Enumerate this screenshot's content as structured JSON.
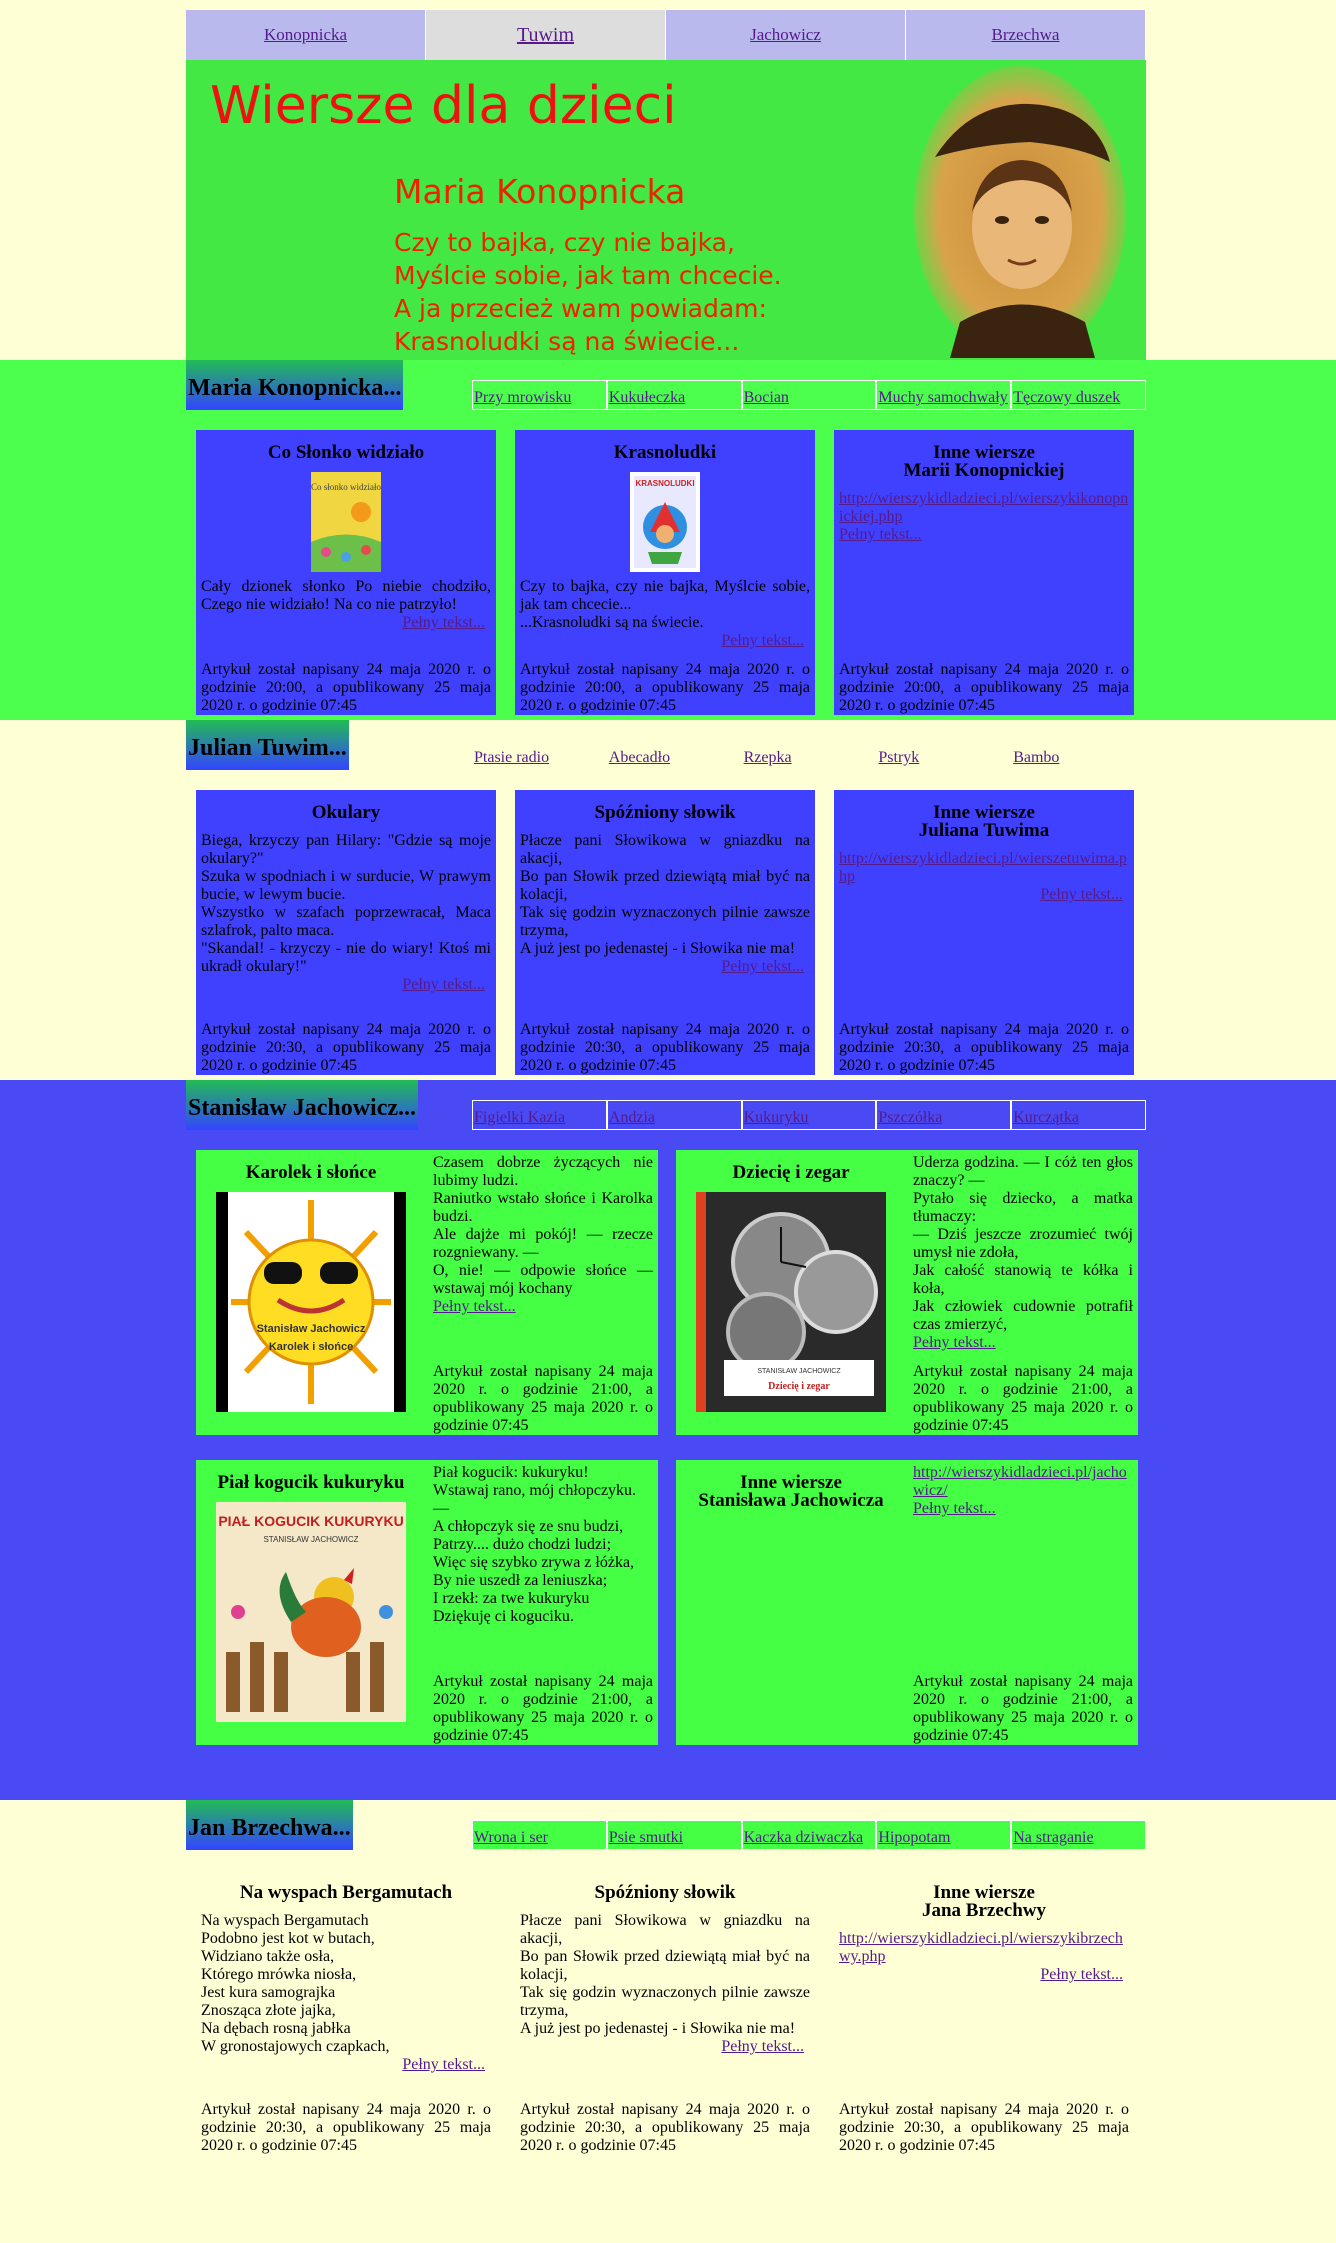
{
  "topnav": [
    "Konopnicka",
    "Tuwim",
    "Jachowicz",
    "Brzechwa"
  ],
  "header": {
    "title": "Wiersze dla dzieci",
    "subtitle": "Maria Konopnicka",
    "verse": "Czy to bajka, czy nie bajka,\nMyślcie sobie, jak tam chcecie.\nA ja przecież wam powiadam:\nKrasnoludki są na świecie..."
  },
  "footer_text": "Artykuł został napisany 24 maja 2020 r. o godzinie 20:00, a opublikowany 25 maja 2020 r. o godzinie 07:45",
  "konopnicka": {
    "title": "Maria Konopnicka...",
    "nav": [
      "Przy mrowisku",
      "Kukułeczka",
      "Bocian",
      "Muchy samochwały",
      "Tęczowy duszek"
    ],
    "cards": [
      {
        "title": "Co Słonko widziało",
        "body": "Cały dzionek słonko Po niebie chodziło, Czego nie widziało! Na co nie patrzyło!",
        "more": "Pełny tekst...",
        "foot": "Artykuł został napisany 24 maja 2020 r. o godzinie 20:00, a opublikowany 25 maja 2020 r. o godzinie 07:45"
      },
      {
        "title": "Krasnoludki",
        "body": "Czy to bajka, czy nie bajka, Myślcie sobie, jak tam chcecie...\n...Krasnoludki są na świecie.",
        "more": "Pełny tekst...",
        "foot": "Artykuł został napisany 24 maja 2020 r. o godzinie 20:00, a opublikowany 25 maja 2020 r. o godzinie 07:45"
      },
      {
        "title": "Inne wiersze\nMarii Konopnickiej",
        "link": "http://wierszykidladzieci.pl/wierszykikonopnickiej.php",
        "more": "Pełny tekst...",
        "foot": "Artykuł został napisany 24 maja 2020 r. o godzinie 20:00, a opublikowany 25 maja 2020 r. o godzinie 07:45"
      }
    ]
  },
  "tuwim": {
    "title": "Julian Tuwim...",
    "nav": [
      "Ptasie radio",
      "Abecadło",
      "Rzepka",
      "Pstryk",
      "Bambo"
    ],
    "cards": [
      {
        "title": "Okulary",
        "body": "Biega, krzyczy pan Hilary: \"Gdzie są moje okulary?\"\nSzuka w spodniach i w surducie, W prawym bucie, w lewym bucie.\nWszystko w szafach poprzewracał, Maca szlafrok, palto maca.\n\"Skandal! - krzyczy - nie do wiary! Ktoś mi ukradł okulary!\"",
        "more": "Pełny tekst...",
        "foot": "Artykuł został napisany 24 maja 2020 r. o godzinie 20:30, a opublikowany 25 maja 2020 r. o godzinie 07:45"
      },
      {
        "title": "Spóźniony słowik",
        "body": "Płacze pani Słowikowa w gniazdku na akacji,\nBo pan Słowik przed dziewiątą miał być na kolacji,\nTak się godzin wyznaczonych pilnie zawsze trzyma,\nA już jest po jedenastej - i Słowika nie ma!",
        "more": "Pełny tekst...",
        "foot": "Artykuł został napisany 24 maja 2020 r. o godzinie 20:30, a opublikowany 25 maja 2020 r. o godzinie 07:45"
      },
      {
        "title": "Inne wiersze\nJuliana Tuwima",
        "link": "http://wierszykidladzieci.pl/wierszetuwima.php",
        "more": "Pełny tekst...",
        "foot": "Artykuł został napisany 24 maja 2020 r. o godzinie 20:30, a opublikowany 25 maja 2020 r. o godzinie 07:45"
      }
    ]
  },
  "jachowicz": {
    "title": "Stanisław Jachowicz...",
    "nav": [
      "Figielki Kazia",
      "Andzia",
      "Kukuryku",
      "Pszczółka",
      "Kurczątka"
    ],
    "cards": [
      {
        "title": "Karolek i słońce",
        "body": "Czasem dobrze życzących nie lubimy ludzi.\nRaniutko wstało słońce i Karolka budzi.\nAle dajże mi pokój! — rzecze rozgniewany. —\nO, nie! — odpowie słońce — wstawaj mój kochany",
        "more": "Pełny tekst...",
        "foot": "Artykuł został napisany 24 maja 2020 r. o godzinie 21:00, a opublikowany 25 maja 2020 r. o godzinie 07:45",
        "cover_author": "Stanisław Jachowicz",
        "cover_title": "Karolek i słońce"
      },
      {
        "title": "Dziecię i zegar",
        "body": "Uderza godzina. — I cóż ten głos znaczy? —\nPytało się dziecko, a matka tłumaczy:\n— Dziś jeszcze zrozumieć twój umysł nie zdoła,\nJak całość stanowią te kółka i koła,\nJak człowiek cudownie potrafił czas zmierzyć,",
        "more": "Pełny tekst...",
        "foot": "Artykuł został napisany 24 maja 2020 r. o godzinie 21:00, a opublikowany 25 maja 2020 r. o godzinie 07:45",
        "cover_author": "STANISŁAW JACHOWICZ",
        "cover_title": "Dziecię i zegar"
      },
      {
        "title": "Piał kogucik kukuryku",
        "body": "Piał kogucik: kukuryku!\nWstawaj rano, mój chłopczyku.\n—\nA chłopczyk się ze snu budzi,\nPatrzy.... dużo chodzi ludzi;\nWięc się szybko zrywa z łóżka,\nBy nie uszedł za leniuszka;\nI rzekł: za twe kukuryku\nDziękuję ci koguciku.",
        "foot": "Artykuł został napisany 24 maja 2020 r. o godzinie 21:00, a opublikowany 25 maja 2020 r. o godzinie 07:45",
        "cover_title": "PIAŁ KOGUCIK KUKURYKU",
        "cover_author": "STANISŁAW JACHOWICZ"
      },
      {
        "title": "Inne wiersze\nStanisława Jachowicza",
        "link": "http://wierszykidladzieci.pl/jachowicz/",
        "more": "Pełny tekst...",
        "foot": "Artykuł został napisany 24 maja 2020 r. o godzinie 21:00, a opublikowany 25 maja 2020 r. o godzinie 07:45"
      }
    ]
  },
  "brzechwa": {
    "title": "Jan Brzechwa...",
    "nav": [
      "Wrona i ser",
      "Psie smutki",
      "Kaczka dziwaczka",
      "Hipopotam",
      "Na straganie"
    ],
    "cards": [
      {
        "title": "Na wyspach Bergamutach",
        "body": "Na wyspach Bergamutach\nPodobno jest kot w butach,\nWidziano także osła,\nKtórego mrówka niosła,\nJest kura samograjka\nZnosząca złote jajka,\nNa dębach rosną jabłka\nW gronostajowych czapkach,",
        "more": "Pełny tekst...",
        "foot": "Artykuł został napisany 24 maja 2020 r. o godzinie 20:30, a opublikowany 25 maja 2020 r. o godzinie 07:45"
      },
      {
        "title": "Spóźniony słowik",
        "body": "Płacze pani Słowikowa w gniazdku na akacji,\nBo pan Słowik przed dziewiątą miał być na kolacji,\nTak się godzin wyznaczonych pilnie zawsze trzyma,\nA już jest po jedenastej - i Słowika nie ma!",
        "more": "Pełny tekst...",
        "foot": "Artykuł został napisany 24 maja 2020 r. o godzinie 20:30, a opublikowany 25 maja 2020 r. o godzinie 07:45"
      },
      {
        "title": "Inne wiersze\nJana Brzechwy",
        "link": "http://wierszykidladzieci.pl/wierszykibrzechwy.php",
        "more": "Pełny tekst...",
        "foot": "Artykuł został napisany 24 maja 2020 r. o godzinie 20:30, a opublikowany 25 maja 2020 r. o godzinie 07:45"
      }
    ]
  },
  "book_covers": {
    "slonko": "Co słonko widziało",
    "krasnoludki": "KRASNOLUDKI"
  }
}
